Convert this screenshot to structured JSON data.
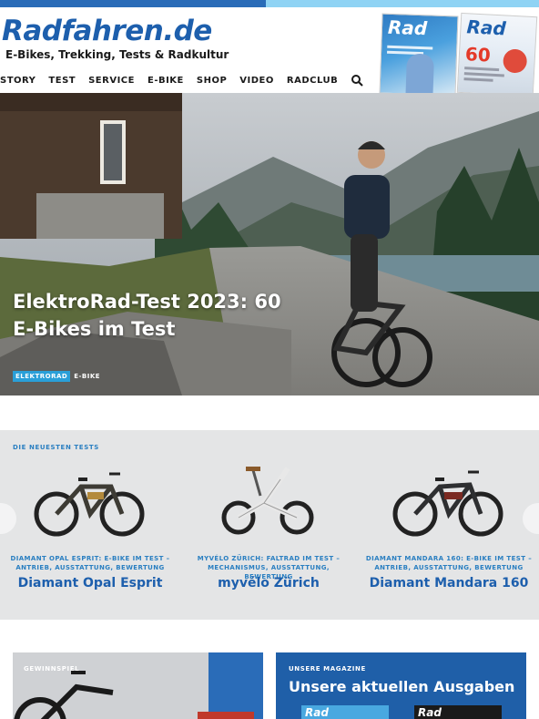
{
  "site": {
    "logo": "Radfahren.de",
    "tagline": "E-Bikes, Trekking, Tests & Radkultur"
  },
  "nav": {
    "items": [
      "STORY",
      "TEST",
      "SERVICE",
      "E-BIKE",
      "SHOP",
      "VIDEO",
      "RADCLUB"
    ],
    "search_icon": "search-icon"
  },
  "magazines": [
    {
      "title": "Rad"
    },
    {
      "title": "Rad",
      "number": "60"
    }
  ],
  "hero": {
    "title": "ElektroRad-Test 2023: 60 E-Bikes im Test",
    "tags": [
      "ELEKTRORAD",
      "E-BIKE"
    ]
  },
  "tests": {
    "label": "DIE NEUESTEN TESTS",
    "cards": [
      {
        "subtitle": "DIAMANT OPAL ESPRIT: E-BIKE IM TEST – ANTRIEB, AUSSTATTUNG, BEWERTUNG",
        "title": "Diamant Opal Esprit"
      },
      {
        "subtitle": "MYVÉLO ZÜRICH: FALTRAD IM TEST – MECHANISMUS, AUSSTATTUNG, BEWERTUNG",
        "title": "myvélo Zürich"
      },
      {
        "subtitle": "DIAMANT MANDARA 160: E-BIKE IM TEST – ANTRIEB, AUSSTATTUNG, BEWERTUNG",
        "title": "Diamant Mandara 160"
      }
    ]
  },
  "promo_left": {
    "label": "GEWINNSPIEL"
  },
  "promo_right": {
    "label": "UNSERE MAGAZINE",
    "title": "Unsere aktuellen Ausgaben",
    "thumb1": "Rad",
    "thumb2": "Rad"
  },
  "colors": {
    "brand_blue": "#1d5fad",
    "accent_cyan": "#2a9fd8"
  }
}
